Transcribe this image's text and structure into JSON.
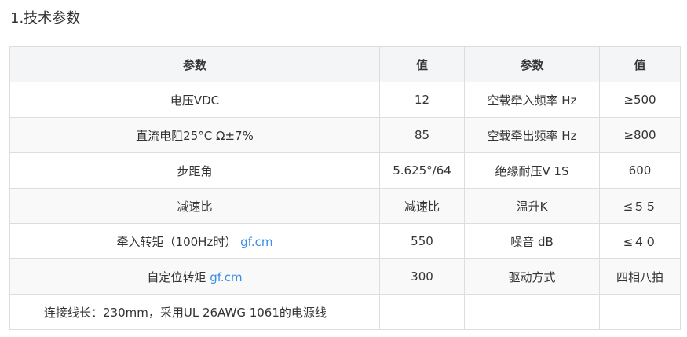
{
  "section": {
    "title": "1.技术参数"
  },
  "table": {
    "headers": [
      "参数",
      "值",
      "参数",
      "值"
    ],
    "rows": [
      {
        "p1": "电压VDC",
        "v1": "12",
        "p2": "空载牵入频率 Hz",
        "v2": "≥500"
      },
      {
        "p1": "直流电阻25°C Ω±7%",
        "v1": "85",
        "p2": "空载牵出频率 Hz",
        "v2": "≥800"
      },
      {
        "p1": "步距角",
        "v1": "5.625°/64",
        "p2": "绝缘耐压V 1S",
        "v2": "600"
      },
      {
        "p1": "减速比",
        "v1": "减速比",
        "p2": "温升K",
        "v2": "≤５５"
      },
      {
        "p1": "牵入转矩（100Hz时）",
        "p1_link": "gf.cm",
        "v1": "550",
        "p2": "噪音 dB",
        "v2": "≤４０"
      },
      {
        "p1": "自定位转矩",
        "p1_link": "gf.cm",
        "v1": "300",
        "p2": "驱动方式",
        "v2": "四相八拍"
      },
      {
        "p1": "连接线长：230mm，采用UL 26AWG 1061的电源线",
        "v1": "",
        "p2": "",
        "v2": ""
      }
    ]
  }
}
